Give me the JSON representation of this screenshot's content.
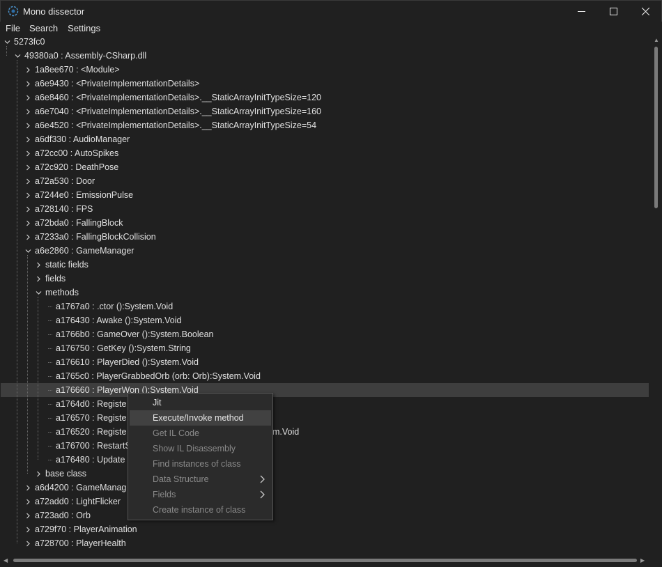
{
  "window": {
    "title": "Mono dissector",
    "minimize_glyph": "—",
    "maximize_glyph": "☐",
    "close_glyph": "✕"
  },
  "menu": [
    "File",
    "Search",
    "Settings"
  ],
  "tree": [
    {
      "label": "5273fc0",
      "level": 0,
      "expanded": true
    },
    {
      "label": "49380a0 : Assembly-CSharp.dll",
      "level": 1,
      "expanded": true
    },
    {
      "label": "1a8ee670 : <Module>",
      "level": 2,
      "expanded": false
    },
    {
      "label": "a6e9430 : <PrivateImplementationDetails>",
      "level": 2,
      "expanded": false
    },
    {
      "label": "a6e8460 : <PrivateImplementationDetails>.__StaticArrayInitTypeSize=120",
      "level": 2,
      "expanded": false
    },
    {
      "label": "a6e7040 : <PrivateImplementationDetails>.__StaticArrayInitTypeSize=160",
      "level": 2,
      "expanded": false
    },
    {
      "label": "a6e4520 : <PrivateImplementationDetails>.__StaticArrayInitTypeSize=54",
      "level": 2,
      "expanded": false
    },
    {
      "label": "a6df330 : AudioManager",
      "level": 2,
      "expanded": false
    },
    {
      "label": "a72cc00 : AutoSpikes",
      "level": 2,
      "expanded": false
    },
    {
      "label": "a72c920 : DeathPose",
      "level": 2,
      "expanded": false
    },
    {
      "label": "a72a530 : Door",
      "level": 2,
      "expanded": false
    },
    {
      "label": "a7244e0 : EmissionPulse",
      "level": 2,
      "expanded": false
    },
    {
      "label": "a728140 : FPS",
      "level": 2,
      "expanded": false
    },
    {
      "label": "a72bda0 : FallingBlock",
      "level": 2,
      "expanded": false
    },
    {
      "label": "a7233a0 : FallingBlockCollision",
      "level": 2,
      "expanded": false
    },
    {
      "label": "a6e2860 : GameManager",
      "level": 2,
      "expanded": true
    },
    {
      "label": "static fields",
      "level": 3,
      "expanded": false
    },
    {
      "label": "fields",
      "level": 3,
      "expanded": false
    },
    {
      "label": "methods",
      "level": 3,
      "expanded": true
    },
    {
      "label": "a1767a0 : .ctor ():System.Void",
      "level": 4,
      "leaf": true
    },
    {
      "label": "a176430 : Awake ():System.Void",
      "level": 4,
      "leaf": true
    },
    {
      "label": "a1766b0 : GameOver ():System.Boolean",
      "level": 4,
      "leaf": true
    },
    {
      "label": "a176750 : GetKey ():System.String",
      "level": 4,
      "leaf": true
    },
    {
      "label": "a176610 : PlayerDied ():System.Void",
      "level": 4,
      "leaf": true
    },
    {
      "label": "a1765c0 : PlayerGrabbedOrb (orb: Orb):System.Void",
      "level": 4,
      "leaf": true
    },
    {
      "label": "a176660 : PlayerWon ():System.Void",
      "level": 4,
      "leaf": true,
      "selected": true
    },
    {
      "label": "a1764d0 : Registe",
      "level": 4,
      "leaf": true
    },
    {
      "label": "a176570 : Registe",
      "level": 4,
      "leaf": true
    },
    {
      "label": "a176520 : Registe",
      "level": 4,
      "leaf": true,
      "tail": "m.Void"
    },
    {
      "label": "a176700 : RestartS",
      "level": 4,
      "leaf": true
    },
    {
      "label": "a176480 : Update",
      "level": 4,
      "leaf": true
    },
    {
      "label": "base class",
      "level": 3,
      "expanded": false
    },
    {
      "label": "a6d4200 : GameManag",
      "level": 2,
      "expanded": false
    },
    {
      "label": "a72add0 : LightFlicker",
      "level": 2,
      "expanded": false
    },
    {
      "label": "a723ad0 : Orb",
      "level": 2,
      "expanded": false
    },
    {
      "label": "a729f70 : PlayerAnimation",
      "level": 2,
      "expanded": false
    },
    {
      "label": "a728700 : PlayerHealth",
      "level": 2,
      "expanded": false
    }
  ],
  "context_menu": [
    {
      "label": "Jit",
      "enabled": true
    },
    {
      "label": "Execute/Invoke method",
      "enabled": true,
      "hover": true
    },
    {
      "label": "Get IL Code",
      "enabled": false
    },
    {
      "label": "Show IL Disassembly",
      "enabled": false
    },
    {
      "label": "Find instances of class",
      "enabled": false
    },
    {
      "label": "Data Structure",
      "enabled": false,
      "submenu": true
    },
    {
      "label": "Fields",
      "enabled": false,
      "submenu": true
    },
    {
      "label": "Create instance of class",
      "enabled": false
    }
  ],
  "colors": {
    "background": "#202020",
    "selected_row": "#3e3e3e",
    "menu_hover": "#414141",
    "disabled_text": "#8a8a8a"
  }
}
